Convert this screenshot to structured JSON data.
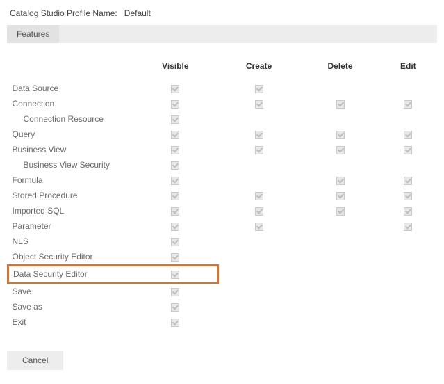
{
  "profile": {
    "label": "Catalog Studio Profile Name:",
    "value": "Default"
  },
  "tabs": {
    "features": "Features"
  },
  "columns": {
    "visible": "Visible",
    "create": "Create",
    "delete": "Delete",
    "edit": "Edit"
  },
  "rows": [
    {
      "label": "Data Source",
      "indent": false,
      "highlight": false,
      "visible": true,
      "create": true,
      "delete": false,
      "edit": false
    },
    {
      "label": "Connection",
      "indent": false,
      "highlight": false,
      "visible": true,
      "create": true,
      "delete": true,
      "edit": true
    },
    {
      "label": "Connection Resource",
      "indent": true,
      "highlight": false,
      "visible": true,
      "create": false,
      "delete": false,
      "edit": false
    },
    {
      "label": "Query",
      "indent": false,
      "highlight": false,
      "visible": true,
      "create": true,
      "delete": true,
      "edit": true
    },
    {
      "label": "Business View",
      "indent": false,
      "highlight": false,
      "visible": true,
      "create": true,
      "delete": true,
      "edit": true
    },
    {
      "label": "Business View Security",
      "indent": true,
      "highlight": false,
      "visible": true,
      "create": false,
      "delete": false,
      "edit": false
    },
    {
      "label": "Formula",
      "indent": false,
      "highlight": false,
      "visible": true,
      "create": false,
      "delete": true,
      "edit": true
    },
    {
      "label": "Stored Procedure",
      "indent": false,
      "highlight": false,
      "visible": true,
      "create": true,
      "delete": true,
      "edit": true
    },
    {
      "label": "Imported SQL",
      "indent": false,
      "highlight": false,
      "visible": true,
      "create": true,
      "delete": true,
      "edit": true
    },
    {
      "label": "Parameter",
      "indent": false,
      "highlight": false,
      "visible": true,
      "create": true,
      "delete": false,
      "edit": true
    },
    {
      "label": "NLS",
      "indent": false,
      "highlight": false,
      "visible": true,
      "create": false,
      "delete": false,
      "edit": false
    },
    {
      "label": "Object Security Editor",
      "indent": false,
      "highlight": false,
      "visible": true,
      "create": false,
      "delete": false,
      "edit": false
    },
    {
      "label": "Data Security Editor",
      "indent": false,
      "highlight": true,
      "visible": true,
      "create": false,
      "delete": false,
      "edit": false
    },
    {
      "label": "Save",
      "indent": false,
      "highlight": false,
      "visible": true,
      "create": false,
      "delete": false,
      "edit": false
    },
    {
      "label": "Save as",
      "indent": false,
      "highlight": false,
      "visible": true,
      "create": false,
      "delete": false,
      "edit": false
    },
    {
      "label": "Exit",
      "indent": false,
      "highlight": false,
      "visible": true,
      "create": false,
      "delete": false,
      "edit": false
    }
  ],
  "buttons": {
    "cancel": "Cancel"
  }
}
